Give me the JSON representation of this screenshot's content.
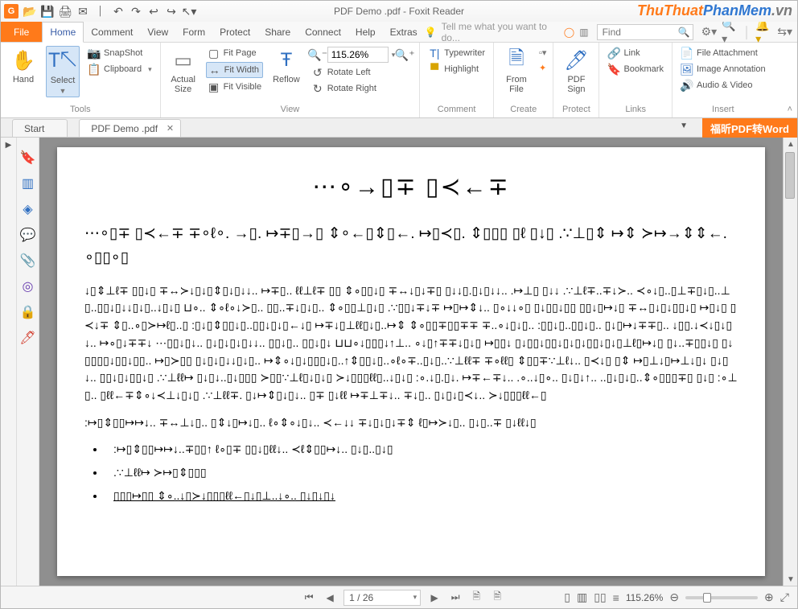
{
  "titlebar": {
    "title": "PDF Demo .pdf - Foxit Reader",
    "watermark": [
      "ThuThuat",
      "PhanMem",
      ".vn"
    ]
  },
  "menu": {
    "file": "File",
    "tabs": [
      "Home",
      "Comment",
      "View",
      "Form",
      "Protect",
      "Share",
      "Connect",
      "Help",
      "Extras"
    ],
    "active": 0,
    "tell_me": "Tell me what you want to do...",
    "find_ph": "Find"
  },
  "ribbon": {
    "groups": {
      "tools": {
        "label": "Tools",
        "hand": "Hand",
        "select": "Select",
        "snapshot": "SnapShot",
        "clipboard": "Clipboard"
      },
      "view": {
        "label": "View",
        "actual": "Actual\nSize",
        "fit_page": "Fit Page",
        "fit_width": "Fit Width",
        "fit_visible": "Fit Visible",
        "reflow": "Reflow",
        "zoom_value": "115.26%",
        "rotate_left": "Rotate Left",
        "rotate_right": "Rotate Right"
      },
      "comment": {
        "label": "Comment",
        "typewriter": "Typewriter",
        "highlight": "Highlight"
      },
      "create": {
        "label": "Create",
        "from_file": "From\nFile"
      },
      "protect": {
        "label": "Protect",
        "pdf_sign": "PDF\nSign"
      },
      "links": {
        "label": "Links",
        "link": "Link",
        "bookmark": "Bookmark"
      },
      "insert": {
        "label": "Insert",
        "file_attachment": "File Attachment",
        "image_annotation": "Image Annotation",
        "audio_video": "Audio & Video"
      }
    }
  },
  "doctabs": {
    "tabs": [
      {
        "label": "Start",
        "active": false
      },
      {
        "label": "PDF Demo .pdf",
        "active": true
      }
    ],
    "orange_btn": "福昕PDF转Word"
  },
  "page_content": {
    "heading": "⋯∘→▯∓ ▯≺←∓",
    "big_para": "⋯∘▯∓ ▯≺←∓ ∓∘ℓ∘. →▯. ↦∓▯→▯ ⇕∘←▯⇕▯←. ↦▯≺▯. ⇕▯▯▯ ▯ℓ ▯↓▯ .∵⊥▯⇕ ↦⇕ ≻↦→⇕⇕←. ∘▯▯∘▯",
    "body": "↓▯⇕⊥ℓ∓ ▯▯↓▯ ∓↔≻↓▯↓▯⇕▯↓▯↓↓.. ↦∓▯.. ℓℓ⊥ℓ∓ ▯▯ ⇕∘▯▯↓▯ ∓↔↓▯↓∓▯ ▯↓↓▯.▯↓▯↓↓.. .↦⊥▯ ▯↓↓ .∵⊥ℓ∓..∓↓≻.. ≺∘↓▯..▯⊥∓▯↓▯..⊥▯..▯▯↓▯↓↓▯↓▯..↓▯↓▯ ⊔∘.. ⇕∘ℓ∘↓≻▯.. ▯▯..∓↓▯↓▯.. ⇕∘▯▯⊥▯↓▯ .∵▯▯↓∓↓∓ ↦▯↦⇕↓.. ▯∘↓↓∘▯ ▯↓▯▯↓▯▯ ▯▯↓▯↦↓▯ ∓↔▯↓▯↓▯▯↓▯ ↦▯↓▯ ▯≺↓∓ ⇕▯..∘▯≻↦ℓ▯..▯ :▯↓▯⇕▯▯↓▯..▯▯↓▯↓▯←↓▯ ↦∓↓▯⊥ℓℓ▯↓▯..↦⇕ ⇕∘▯▯∓▯▯∓∓ ∓..∘↓▯↓▯.. :▯▯↓▯..▯▯↓▯.. ▯↓▯↦↓∓∓▯.. ↓▯▯.↓≺↓▯↓▯↓.. ↦∘▯↓∓∓↓ ⋯▯▯↓▯↓.. ▯↓▯↓▯↓▯↓↓.. ▯▯↓▯.. ▯▯↓▯↓ ⊔⊔∘↓▯▯▯↓↑⊥.. ∘↓▯↑∓∓↓▯↓▯ ↦▯▯↓ ▯↓▯▯↓▯▯↓▯↓▯↓▯▯↓▯↓▯⊥ℓ▯↦↓▯ ▯↓..∓▯▯↓▯ ▯↓▯▯▯▯↓▯▯↓▯▯.. ↦▯≻▯▯ ▯↓▯↓▯↓↓▯↓▯.. ↦⇕∘↓▯↓▯▯▯↓▯..↑⇕▯▯↓▯..∘ℓ∘∓..▯↓▯..∵⊥ℓℓ∓ ∓∘ℓℓ▯ ⇕▯▯∓∵⊥ℓ↓.. ▯≺↓▯ ▯⇕ ↦▯⊥↓▯↦⊥↓▯↓ ▯↓▯↓.. ▯▯↓▯↓▯▯↓▯ .∵⊥ℓℓ↦ ▯↓▯↓..▯↓▯▯▯ ≻▯▯∵⊥ℓ▯↓▯↓▯ ≻↓▯▯▯ℓℓ▯..↓▯↓▯ :∘.↓▯.▯↓. ↦∓←∓↓.. .∘..↓▯∘.. ▯↓▯↓↑.. ..▯↓▯↓▯..⇕∘▯▯▯∓▯ ▯↓▯ :∘⊥▯.. ▯ℓℓ←∓⇕∘↓≺⊥↓▯↓▯ .∵⊥ℓℓ∓. ▯↓↦⇕▯↓▯↓.. ▯∓ ▯↓ℓℓ ↦∓⊥∓↓.. ∓↓▯.. ▯↓▯↓▯≺↓.. ≻↓▯▯▯ℓℓ←▯",
    "separate": ":↦▯⇕▯▯↦↦↓.. ∓↔⊥↓▯.. ▯⇕↓▯↦↓▯.. ℓ∘⇕∘↓▯↓.. ≺←↓↓ ∓↓▯↓▯↓∓⇕ ℓ▯↦≻↓▯.. ▯↓▯..∓ ▯↓ℓℓ↓▯",
    "bullets": [
      ":↦▯⇕▯▯↦↦↓..∓▯▯↑ ℓ∘▯∓ ▯▯↓▯ℓℓ↓.. ≺ℓ⇕▯▯↦↓.. ▯↓▯..▯↓▯",
      ".∵⊥ℓℓ↦ ≻↦▯⇕▯▯▯",
      "▯▯▯↦▯▯ ⇕∘..↓▯≻↓▯▯▯ℓℓ←▯↓▯⊥..↓∘.. ▯↓▯↓▯↓"
    ]
  },
  "status": {
    "page_display": "1 / 26",
    "zoom": "115.26%"
  }
}
